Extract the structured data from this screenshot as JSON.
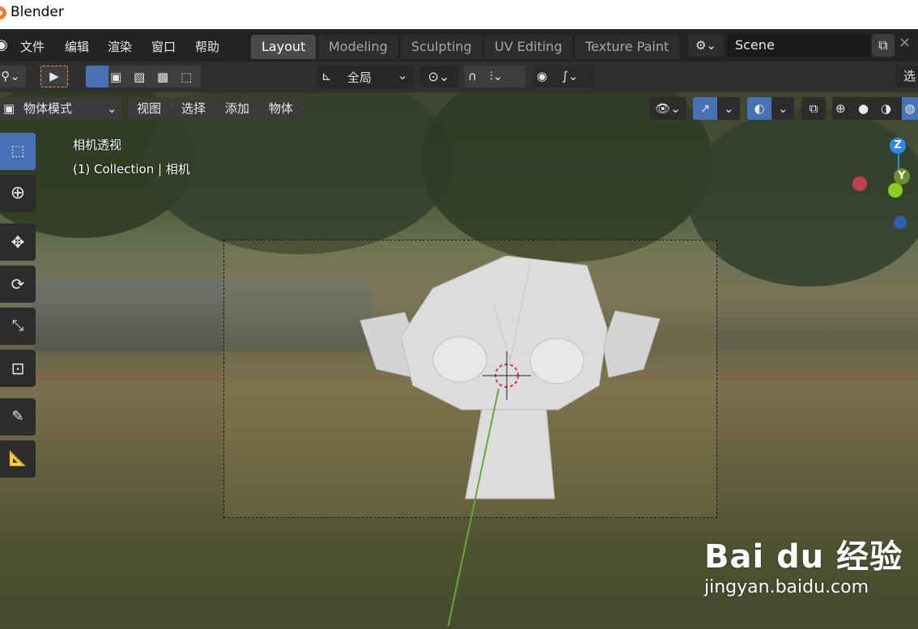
{
  "window": {
    "title": "Blender"
  },
  "menubar": {
    "items": [
      "文件",
      "编辑",
      "渲染",
      "窗口",
      "帮助"
    ],
    "tabs": [
      {
        "label": "Layout",
        "active": true
      },
      {
        "label": "Modeling",
        "active": false
      },
      {
        "label": "Sculpting",
        "active": false
      },
      {
        "label": "UV Editing",
        "active": false
      },
      {
        "label": "Texture Paint",
        "active": false
      }
    ],
    "scene": "Scene"
  },
  "toolbar": {
    "orientation": "全局",
    "select_label": "选"
  },
  "viewport_header": {
    "mode": "物体模式",
    "menus": [
      "视图",
      "选择",
      "添加",
      "物体"
    ]
  },
  "overlay": {
    "view_name": "相机透视",
    "collection_info": "(1) Collection | 相机"
  },
  "gizmo": {
    "z": "Z",
    "y": "Y"
  },
  "watermark": {
    "brand": "Bai du 经验",
    "url": "jingyan.baidu.com"
  },
  "colors": {
    "accent": "#4772b3",
    "active_tab": "#4a4a4a",
    "x_axis": "#c4404c",
    "y_axis": "#8ccd1f",
    "z_axis": "#2f86ea"
  }
}
